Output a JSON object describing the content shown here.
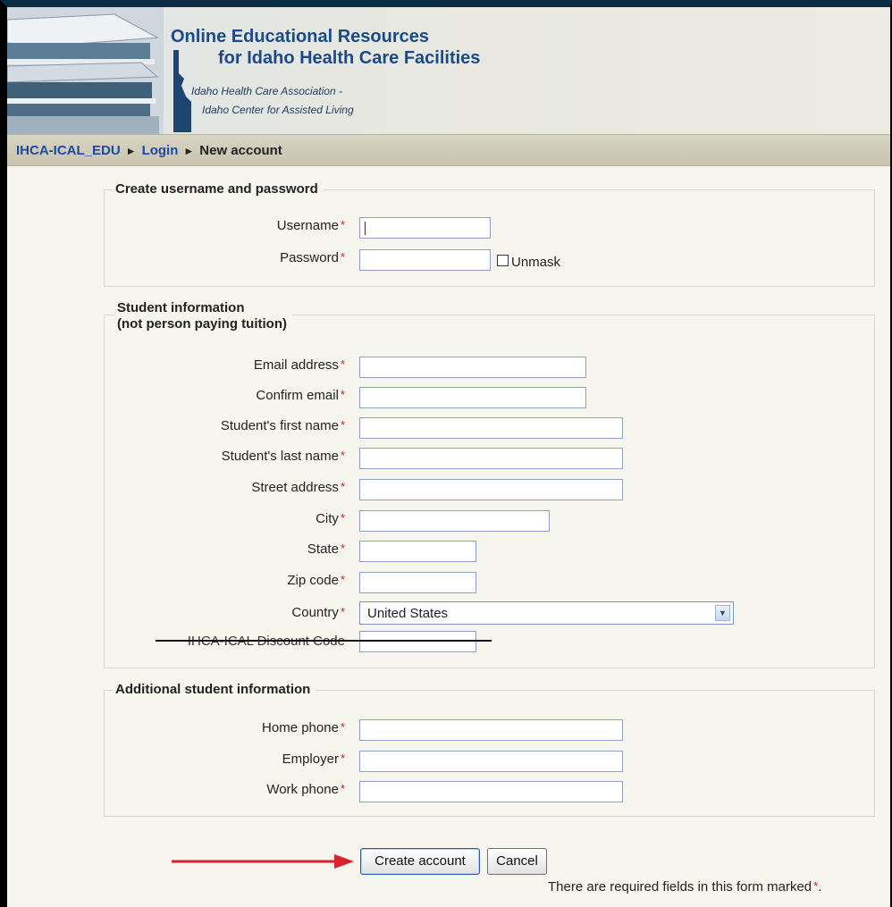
{
  "banner": {
    "title_line1": "Online Educational Resources",
    "title_line2": "for Idaho Health Care Facilities",
    "assoc_line1": "Idaho Health Care Association -",
    "assoc_line2": "Idaho Center for Assisted Living"
  },
  "breadcrumb": {
    "home": "IHCA-ICAL_EDU",
    "sep": "►",
    "login": "Login",
    "current": "New account"
  },
  "sections": {
    "credentials": {
      "legend": "Create username and password",
      "username_label": "Username",
      "password_label": "Password",
      "unmask_label": "Unmask"
    },
    "student": {
      "legend_line1": "Student information",
      "legend_line2": "(not person paying tuition)",
      "email_label": "Email address",
      "confirm_email_label": "Confirm email",
      "first_name_label": "Student's first name",
      "last_name_label": "Student's last name",
      "street_label": "Street address",
      "city_label": "City",
      "state_label": "State",
      "zip_label": "Zip code",
      "country_label": "Country",
      "country_value": "United States",
      "discount_label": "IHCA-ICAL Discount Code"
    },
    "additional": {
      "legend": "Additional student information",
      "home_phone_label": "Home phone",
      "employer_label": "Employer",
      "work_phone_label": "Work phone"
    }
  },
  "required_mark": "*",
  "buttons": {
    "create": "Create account",
    "cancel": "Cancel"
  },
  "footer_note": "There are required fields in this form marked",
  "footer_note_end": ".",
  "colors": {
    "link": "#1b4aa0",
    "required": "#d81b1b",
    "arrow": "#d8232a",
    "banner_title": "#1b4a8a"
  }
}
